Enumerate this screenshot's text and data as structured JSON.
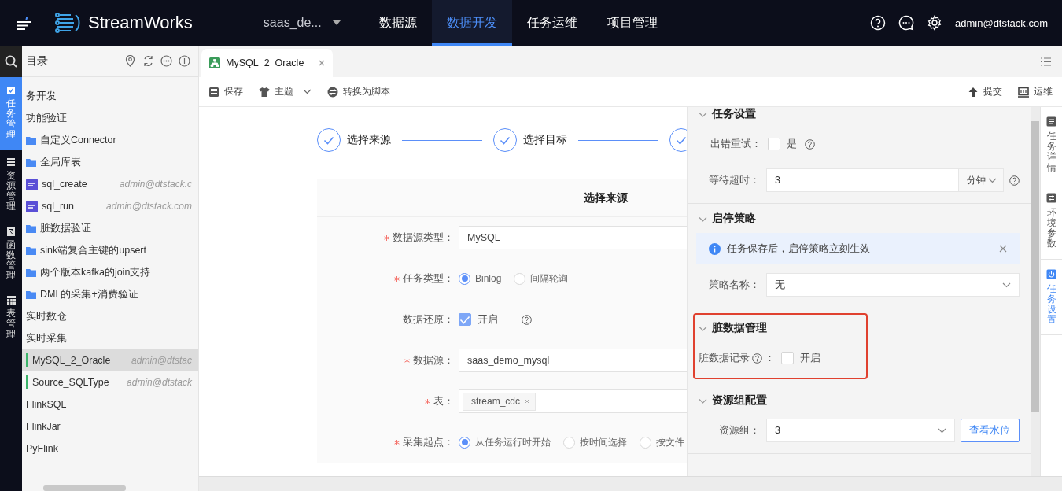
{
  "topbar": {
    "brand": "StreamWorks",
    "project": "saas_de...",
    "nav": [
      {
        "label": "数据源",
        "selected": false
      },
      {
        "label": "数据开发",
        "selected": true
      },
      {
        "label": "任务运维",
        "selected": false
      },
      {
        "label": "项目管理",
        "selected": false
      }
    ],
    "user": "admin@dtstack.com"
  },
  "rail": [
    {
      "label": "任务管理",
      "kind": "task",
      "selected": true
    },
    {
      "label": "资源管理",
      "kind": "resource",
      "selected": false
    },
    {
      "label": "函数管理",
      "kind": "function",
      "selected": false
    },
    {
      "label": "表管理",
      "kind": "table",
      "selected": false
    }
  ],
  "sidebar": {
    "title": "目录",
    "items": [
      {
        "label": "务开发",
        "selected": false,
        "children": [
          {
            "label": "功能验证",
            "selected": false
          },
          {
            "label": "自定义Connector",
            "kind": "folder",
            "selected": false
          },
          {
            "label": "全局库表",
            "kind": "folder",
            "selected": false
          },
          {
            "label": "sql_create",
            "kind": "sql",
            "owner": "admin@dtstack.c",
            "selected": false
          },
          {
            "label": "sql_run",
            "kind": "sql",
            "owner": "admin@dtstack.com",
            "selected": false
          },
          {
            "label": "脏数据验证",
            "kind": "folder",
            "selected": false
          },
          {
            "label": "sink端复合主键的upsert",
            "kind": "folder",
            "selected": false
          },
          {
            "label": "两个版本kafka的join支持",
            "kind": "folder",
            "selected": false
          },
          {
            "label": "DML的采集+消费验证",
            "kind": "folder",
            "selected": false
          },
          {
            "label": "实时数仓",
            "selected": false
          },
          {
            "label": "实时采集",
            "selected": false
          },
          {
            "label": "MySQL_2_Oracle",
            "kind": "task",
            "owner": "admin@dtstac",
            "selected": true
          },
          {
            "label": "Source_SQLType",
            "kind": "task",
            "owner": "admin@dtstack",
            "selected": false
          },
          {
            "label": "FlinkSQL",
            "selected": false
          },
          {
            "label": "FlinkJar",
            "selected": false
          },
          {
            "label": "PyFlink",
            "selected": false
          }
        ]
      }
    ]
  },
  "tabs": [
    {
      "label": "MySQL_2_Oracle",
      "selected": true
    }
  ],
  "toolbar": {
    "left": [
      {
        "label": "保存",
        "kind": "save"
      },
      {
        "label": "主题",
        "kind": "theme"
      },
      {
        "label": "转换为脚本",
        "kind": "convert"
      }
    ],
    "right": [
      {
        "label": "提交",
        "kind": "submit"
      },
      {
        "label": "运维",
        "kind": "ops"
      }
    ]
  },
  "steps": [
    {
      "label": "选择来源",
      "done": true
    },
    {
      "label": "选择目标",
      "done": true
    },
    {
      "done": true
    }
  ],
  "form": {
    "title": "选择来源",
    "rows": [
      {
        "label": "数据源类型：",
        "required": true,
        "kind": "input",
        "value": "MySQL"
      },
      {
        "label": "任务类型：",
        "required": true,
        "kind": "radio",
        "options": [
          {
            "label": "Binlog",
            "selected": true
          },
          {
            "label": "间隔轮询",
            "selected": false
          }
        ]
      },
      {
        "label": "数据还原：",
        "required": false,
        "kind": "checkbox",
        "checked": true,
        "text": "开启",
        "help": true
      },
      {
        "label": "数据源：",
        "required": true,
        "kind": "input",
        "value": "saas_demo_mysql"
      },
      {
        "label": "表：",
        "required": true,
        "kind": "tags",
        "tags": [
          "stream_cdc"
        ]
      },
      {
        "label": "采集起点：",
        "required": true,
        "kind": "radio",
        "options": [
          {
            "label": "从任务运行时开始",
            "selected": true
          },
          {
            "label": "按时间选择",
            "selected": false
          },
          {
            "label": "按文件",
            "selected": false
          }
        ]
      }
    ]
  },
  "settings": {
    "sections": [
      {
        "title": "任务设置",
        "expanded": true,
        "highlighted": false,
        "rows": [
          {
            "kind": "checkbox",
            "label": "出错重试：",
            "checked": false,
            "text": "是",
            "help": true
          },
          {
            "kind": "input_unit",
            "label": "等待超时：",
            "value": "3",
            "unit": "分钟",
            "help": true
          }
        ]
      },
      {
        "title": "启停策略",
        "expanded": true,
        "highlighted": false,
        "rows": [
          {
            "kind": "alert",
            "text": "任务保存后，启停策略立刻生效"
          },
          {
            "kind": "select",
            "label": "策略名称：",
            "value": "无"
          }
        ]
      },
      {
        "title": "脏数据管理",
        "expanded": true,
        "highlighted": true,
        "rows": [
          {
            "kind": "checkbox_left",
            "label": "脏数据记录",
            "suffix": "：",
            "checked": false,
            "text": "开启",
            "help": true
          }
        ]
      },
      {
        "title": "资源组配置",
        "expanded": true,
        "highlighted": false,
        "rows": [
          {
            "kind": "select_button",
            "label": "资源组：",
            "value": "3",
            "button": "查看水位"
          }
        ]
      }
    ]
  },
  "side_tabs": [
    {
      "label": "任务详情",
      "kind": "detail",
      "selected": false
    },
    {
      "label": "环境参数",
      "kind": "params",
      "selected": false
    },
    {
      "label": "任务设置",
      "kind": "settings",
      "selected": true
    }
  ]
}
